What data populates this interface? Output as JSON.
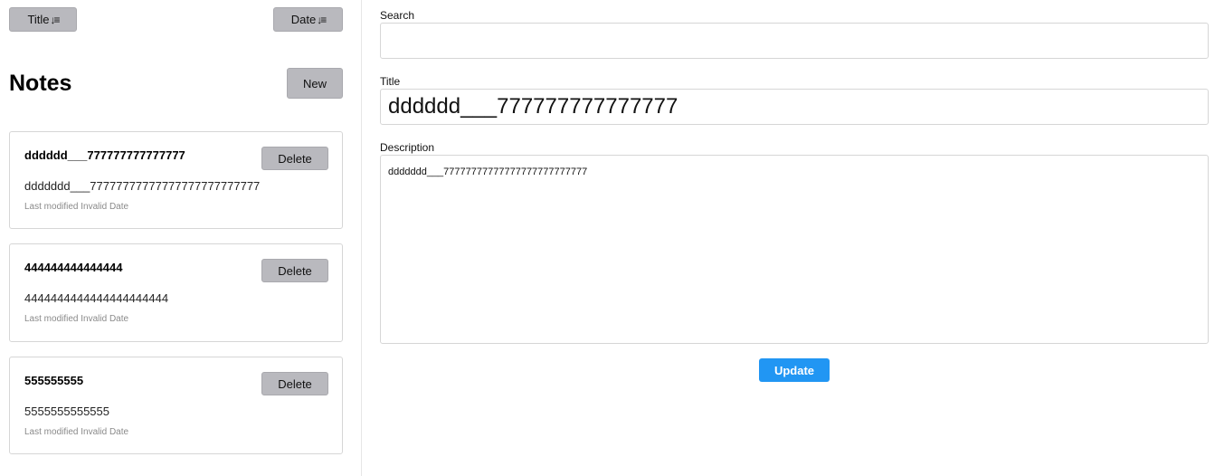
{
  "sidebar": {
    "sort_title_label": "Title",
    "sort_date_label": "Date",
    "sort_icon_glyph": "↓≡",
    "heading": "Notes",
    "new_label": "New",
    "notes": [
      {
        "title": "dddddd___777777777777777",
        "description": "ddddddd___77777777777777777777777777",
        "modified": "Last modified Invalid Date",
        "delete_label": "Delete"
      },
      {
        "title": "444444444444444",
        "description": "4444444444444444444444",
        "modified": "Last modified Invalid Date",
        "delete_label": "Delete"
      },
      {
        "title": "555555555",
        "description": "5555555555555",
        "modified": "Last modified Invalid Date",
        "delete_label": "Delete"
      }
    ]
  },
  "editor": {
    "search_label": "Search",
    "search_value": "",
    "title_label": "Title",
    "title_value": "dddddd___777777777777777",
    "description_label": "Description",
    "description_value": "ddddddd___77777777777777777777777777",
    "update_label": "Update"
  },
  "colors": {
    "button_gray": "#b9b9be",
    "accent": "#2196f3"
  }
}
